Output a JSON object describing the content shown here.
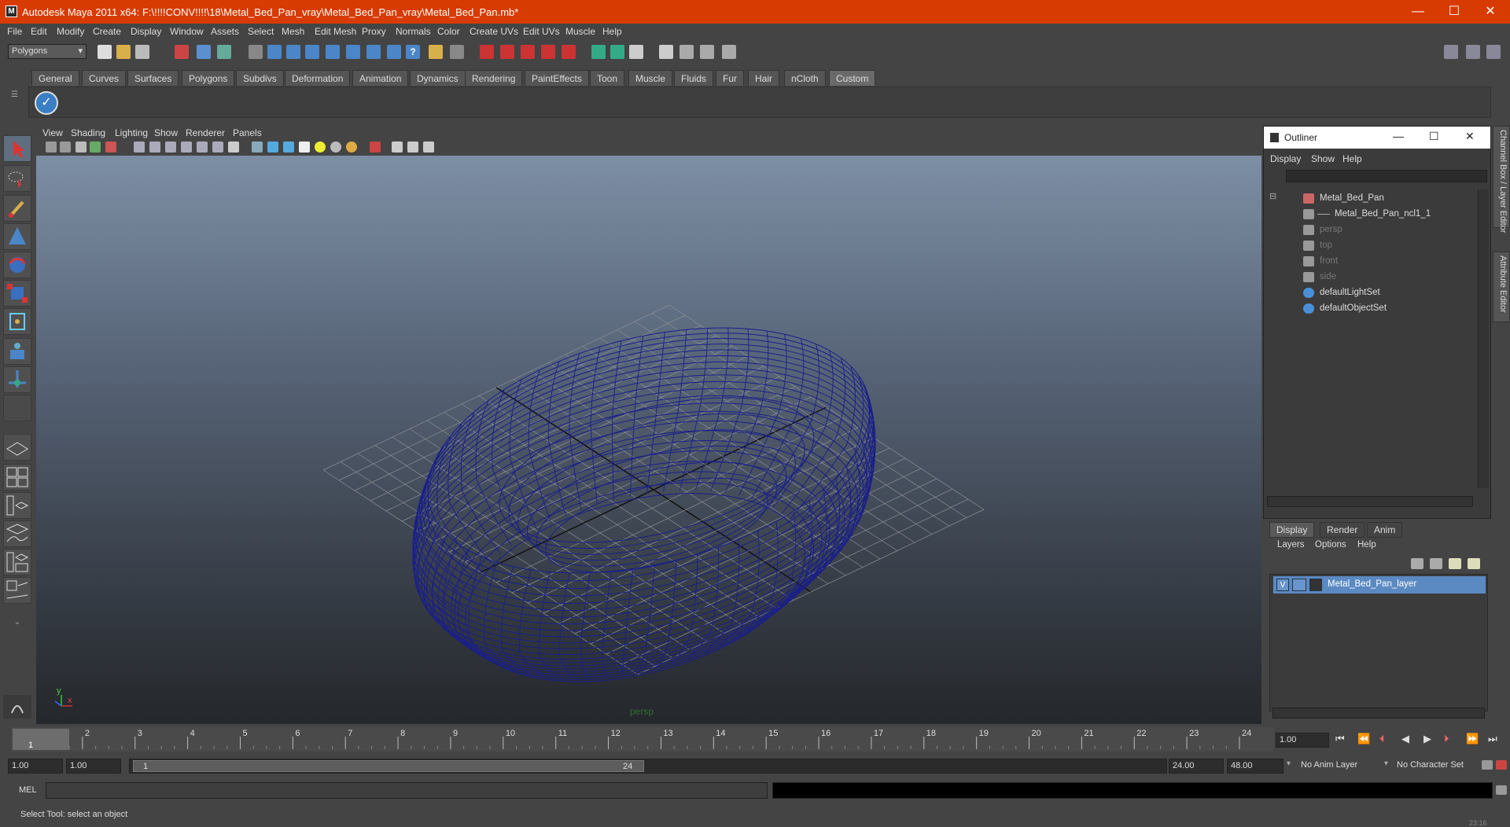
{
  "window": {
    "title": "Autodesk Maya 2011 x64: F:\\!!!!CONV!!!!\\18\\Metal_Bed_Pan_vray\\Metal_Bed_Pan_vray\\Metal_Bed_Pan.mb*",
    "minimize": "—",
    "maximize": "☐",
    "close": "✕"
  },
  "menu": [
    "File",
    "Edit",
    "Modify",
    "Create",
    "Display",
    "Window",
    "Assets",
    "Select",
    "Mesh",
    "Edit Mesh",
    "Proxy",
    "Normals",
    "Color",
    "Create UVs",
    "Edit UVs",
    "Muscle",
    "Help"
  ],
  "mode_select": {
    "value": "Polygons"
  },
  "shelf_tabs": [
    "General",
    "Curves",
    "Surfaces",
    "Polygons",
    "Subdivs",
    "Deformation",
    "Animation",
    "Dynamics",
    "Rendering",
    "PaintEffects",
    "Toon",
    "Muscle",
    "Fluids",
    "Fur",
    "Hair",
    "nCloth",
    "Custom"
  ],
  "shelf_active": "Custom",
  "panel_menu": [
    "View",
    "Shading",
    "Lighting",
    "Show",
    "Renderer",
    "Panels"
  ],
  "viewport": {
    "camera_label": "persp",
    "axis_x": "x",
    "axis_y": "y",
    "wire_color": "#1a1f8a"
  },
  "outliner": {
    "title": "Outliner",
    "menu": [
      "Display",
      "Show",
      "Help"
    ],
    "items": [
      {
        "label": "Metal_Bed_Pan",
        "dim": false,
        "indent": 0
      },
      {
        "label": "Metal_Bed_Pan_ncl1_1",
        "dim": false,
        "indent": 1
      },
      {
        "label": "persp",
        "dim": true,
        "indent": 0
      },
      {
        "label": "top",
        "dim": true,
        "indent": 0
      },
      {
        "label": "front",
        "dim": true,
        "indent": 0
      },
      {
        "label": "side",
        "dim": true,
        "indent": 0
      },
      {
        "label": "defaultLightSet",
        "dim": false,
        "indent": 0
      },
      {
        "label": "defaultObjectSet",
        "dim": false,
        "indent": 0
      }
    ]
  },
  "side_tabs": {
    "channel_box": "Channel Box / Layer Editor",
    "attribute_editor": "Attribute Editor"
  },
  "layer_editor": {
    "tabs": [
      "Display",
      "Render",
      "Anim"
    ],
    "active_tab": "Display",
    "menu": [
      "Layers",
      "Options",
      "Help"
    ],
    "layer": {
      "visible": "V",
      "name": "Metal_Bed_Pan_layer"
    }
  },
  "timeline": {
    "ticks": [
      "1",
      "2",
      "3",
      "4",
      "5",
      "6",
      "7",
      "8",
      "9",
      "10",
      "11",
      "12",
      "13",
      "14",
      "15",
      "16",
      "17",
      "18",
      "19",
      "20",
      "21",
      "22",
      "23",
      "24"
    ],
    "current_frame": "1",
    "current_field": "1.00"
  },
  "range": {
    "start": "1.00",
    "inner_start": "1.00",
    "slider_start": "1",
    "slider_end": "24",
    "end": "24.00",
    "outer_end": "48.00",
    "anim_layer": "No Anim Layer",
    "char_set": "No Character Set"
  },
  "command": {
    "label": "MEL"
  },
  "help_line": "Select Tool: select an object",
  "taskbar_time": "23:16"
}
